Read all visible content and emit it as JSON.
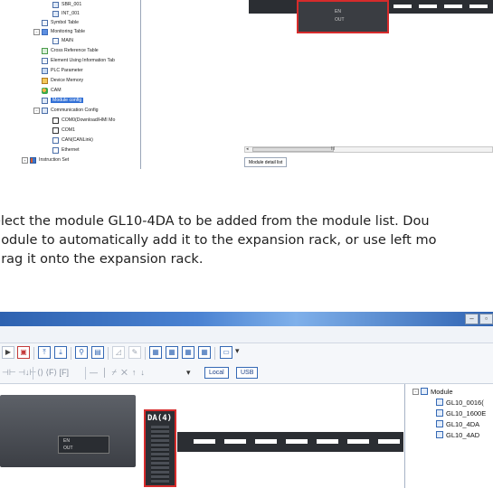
{
  "top_screenshot": {
    "tree_items": [
      {
        "label": "SBR_001",
        "icon": "doc-icon"
      },
      {
        "label": "INT_001",
        "icon": "doc-icon"
      },
      {
        "label": "Symbol Table",
        "icon": "table-icon"
      },
      {
        "label": "Monitoring Table",
        "icon": "folder-icon"
      },
      {
        "label": "MAIN",
        "icon": "table-icon"
      },
      {
        "label": "Cross Reference Table",
        "icon": "ref-icon"
      },
      {
        "label": "Element Using Information Tab",
        "icon": "table-icon"
      },
      {
        "label": "PLC Parameter",
        "icon": "plc-icon"
      },
      {
        "label": "Device Memory",
        "icon": "memory-icon"
      },
      {
        "label": "CAM",
        "icon": "cam-icon"
      },
      {
        "label": "Module config",
        "icon": "doc-icon"
      },
      {
        "label": "Communication Config",
        "icon": "doc-icon"
      },
      {
        "label": "COM0(Download/HMI Mo",
        "icon": "checkbox-icon"
      },
      {
        "label": "COM1",
        "icon": "checkbox-icon"
      },
      {
        "label": "CAN(CANLink)",
        "icon": "comm-icon"
      },
      {
        "label": "Ethernet",
        "icon": "comm-icon"
      },
      {
        "label": "Instruction Set",
        "icon": "book-icon"
      }
    ],
    "plc_labels": {
      "en": "EN",
      "out": "OUT"
    },
    "scroll_mid": "III",
    "tab_label": "Module detail list"
  },
  "instruction": {
    "line1": "elect the module GL10-4DA to be added from the module list. Dou",
    "line2": "nodule to automatically add it to the expansion rack, or use left mo",
    "line3": "drag it onto the expansion rack."
  },
  "bottom_screenshot": {
    "window_buttons": {
      "minimize": "–",
      "restore": "▫"
    },
    "toolbar_buttons": {
      "local": "Local",
      "usb": "USB"
    },
    "plc_labels": {
      "en": "EN",
      "out": "OUT"
    },
    "added_module_label": "DA(4)",
    "module_tree": {
      "root": "Module",
      "items": [
        "GL10_0016(",
        "GL10_1600E",
        "GL10_4DA",
        "GL10_4AD"
      ]
    }
  },
  "colors": {
    "selection": "#3270d6",
    "highlight_border": "#d62b2b",
    "rail": "#2b2e33",
    "titlebar": "#2e62b0"
  }
}
